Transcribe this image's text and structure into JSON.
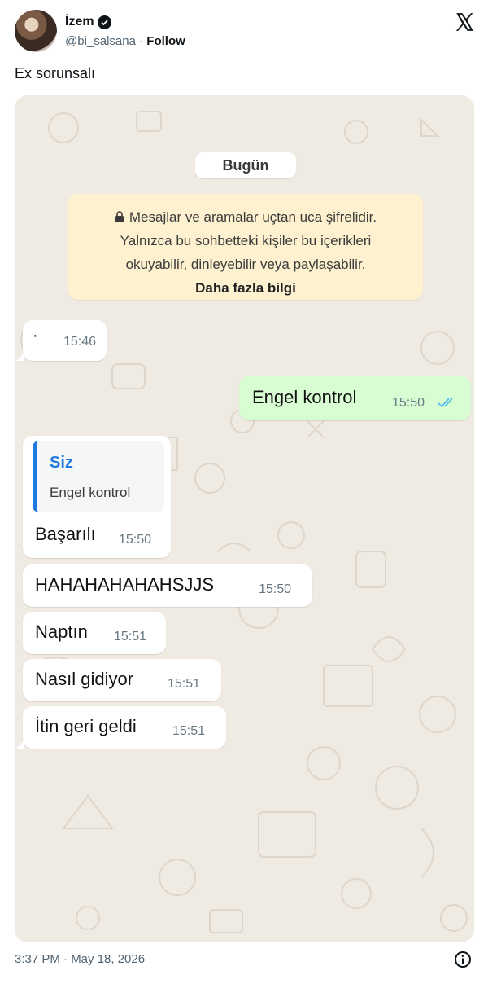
{
  "tweet": {
    "author_name": "İzem",
    "handle": "@bi_salsana",
    "separator": "·",
    "follow_label": "Follow",
    "text": "Ex sorunsalı",
    "timestamp": "3:37 PM · May 18, 2026"
  },
  "chat": {
    "date_label": "Bugün",
    "encryption": {
      "line1": "Mesajlar ve aramalar uçtan uca şifrelidir.",
      "line2": "Yalnızca bu sohbetteki kişiler bu içerikleri",
      "line3": "okuyabilir, dinleyebilir veya paylaşabilir.",
      "link": "Daha fazla bilgi"
    },
    "messages": [
      {
        "text": "·",
        "time": "15:46",
        "direction": "in"
      },
      {
        "text": "Engel kontrol",
        "time": "15:50",
        "direction": "out",
        "status": "read"
      },
      {
        "quote_author": "Siz",
        "quote_text": "Engel kontrol",
        "text": "Başarılı",
        "time": "15:50",
        "direction": "in"
      },
      {
        "text": "HAHAHAHAHAHSJJS",
        "time": "15:50",
        "direction": "in"
      },
      {
        "text": "Naptın",
        "time": "15:51",
        "direction": "in"
      },
      {
        "text": "Nasıl gidiyor",
        "time": "15:51",
        "direction": "in"
      },
      {
        "text": "İtin geri geldi",
        "time": "15:51",
        "direction": "in"
      }
    ],
    "colors": {
      "background": "#efeae2",
      "outgoing": "#d9fdd3",
      "incoming": "#ffffff",
      "read_ticks": "#53bdeb",
      "quote_accent": "#1f7be0",
      "encryption_box": "#fdf1cf"
    }
  }
}
